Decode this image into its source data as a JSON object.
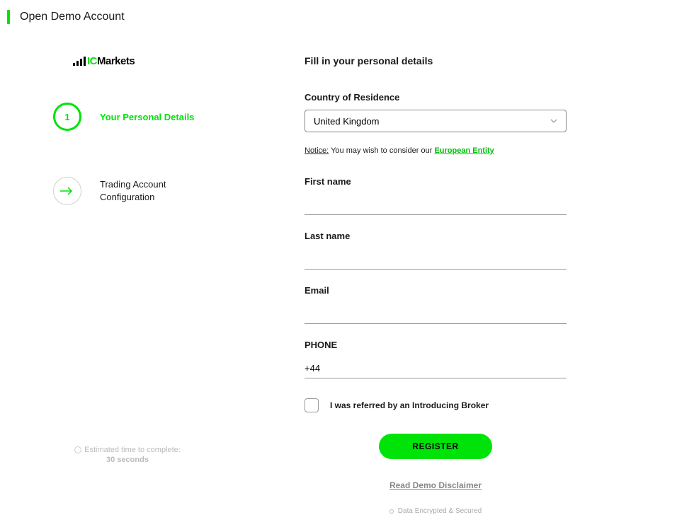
{
  "header": {
    "title": "Open Demo Account"
  },
  "logo": {
    "ic": "IC",
    "markets": "Markets"
  },
  "steps": {
    "step1": {
      "number": "1",
      "label": "Your Personal Details"
    },
    "step2": {
      "label": "Trading Account\nConfiguration"
    }
  },
  "form": {
    "title": "Fill in your personal details",
    "country_label": "Country of Residence",
    "country_value": "United Kingdom",
    "notice_label": "Notice:",
    "notice_text": " You may wish to consider our ",
    "notice_link": "European Entity",
    "first_name_label": "First name",
    "first_name_value": "",
    "last_name_label": "Last name",
    "last_name_value": "",
    "email_label": "Email",
    "email_value": "",
    "phone_label": "PHONE",
    "phone_value": "+44",
    "checkbox_label": "I was referred by an Introducing Broker",
    "register_label": "REGISTER",
    "disclaimer_label": "Read Demo Disclaimer",
    "encrypted_label": "Data Encrypted & Secured"
  },
  "footer": {
    "estimate_label": "Estimated time to complete:",
    "estimate_value": "30 seconds"
  }
}
